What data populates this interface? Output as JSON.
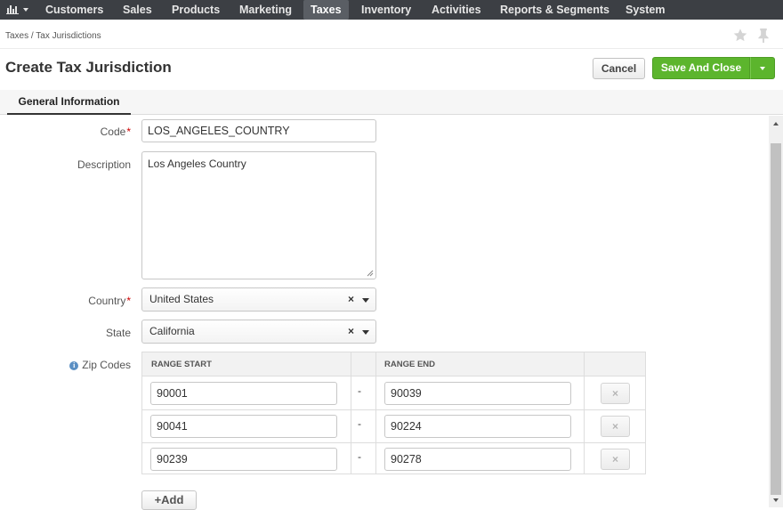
{
  "nav": {
    "items": [
      "Customers",
      "Sales",
      "Products",
      "Marketing",
      "Taxes",
      "Inventory",
      "Activities",
      "Reports & Segments",
      "System"
    ],
    "active": "Taxes"
  },
  "breadcrumb": "Taxes / Tax Jurisdictions",
  "page": {
    "title": "Create Tax Jurisdiction",
    "cancel_label": "Cancel",
    "save_label": "Save And Close"
  },
  "tabs": [
    "General Information"
  ],
  "form": {
    "code_label": "Code",
    "code_value": "LOS_ANGELES_COUNTRY",
    "required_mark": "*",
    "description_label": "Description",
    "description_value": "Los Angeles Country",
    "country_label": "Country",
    "country_value": "United States",
    "state_label": "State",
    "state_value": "California",
    "zip_label": "Zip Codes",
    "clear_glyph": "×",
    "info_glyph": "i"
  },
  "zip_table": {
    "col_start": "RANGE START",
    "col_end": "RANGE END",
    "separator": "-",
    "remove_glyph": "×",
    "rows": [
      {
        "start": "90001",
        "end": "90039"
      },
      {
        "start": "90041",
        "end": "90224"
      },
      {
        "start": "90239",
        "end": "90278"
      }
    ]
  },
  "add_label": "+Add",
  "colors": {
    "nav_bg": "#3c3f44",
    "save_green": "#5cb52d",
    "required_red": "#cc0000",
    "info_blue": "#5b8fc3"
  }
}
